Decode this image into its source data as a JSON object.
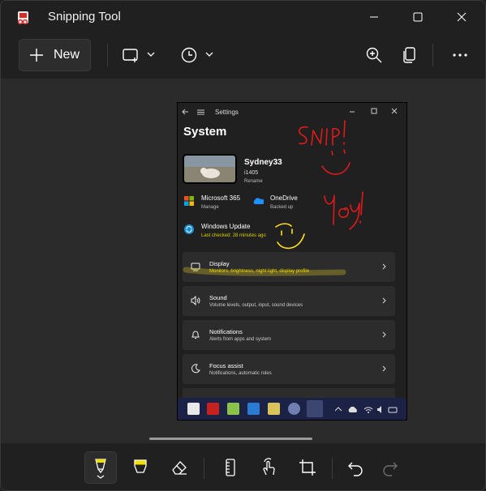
{
  "window": {
    "title": "Snipping Tool"
  },
  "toolbar": {
    "new_label": "New"
  },
  "screenshot": {
    "window_title": "Settings",
    "heading": "System",
    "pc_name": "Sydney33",
    "pc_model": "i1405",
    "rename_label": "Rename",
    "quick": [
      {
        "title": "Microsoft 365",
        "sub": "Manage"
      },
      {
        "title": "OneDrive",
        "sub": "Backed up"
      },
      {
        "title": "Windows Update",
        "sub": "Last checked: 28 minutes ago"
      }
    ],
    "cards": [
      {
        "title": "Display",
        "sub": "Monitors, brightness, night light, display profile"
      },
      {
        "title": "Sound",
        "sub": "Volume levels, output, input, sound devices"
      },
      {
        "title": "Notifications",
        "sub": "Alerts from apps and system"
      },
      {
        "title": "Focus assist",
        "sub": "Notifications, automatic rules"
      }
    ]
  },
  "annotations": {
    "red_texts": [
      "SNIP!",
      "Yay!"
    ]
  },
  "colors": {
    "accent_yellow": "#f0e000",
    "ink_red": "#e01a1a",
    "ink_yellow": "#ffe21f",
    "taskbar": "#1b2245"
  }
}
